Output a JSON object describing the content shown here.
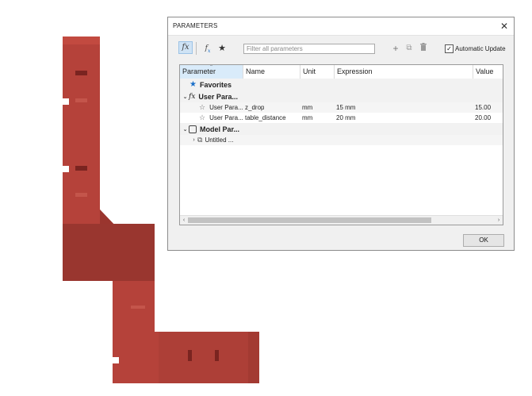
{
  "dialog": {
    "title": "PARAMETERS",
    "close_glyph": "✕",
    "filter_placeholder": "Filter all parameters",
    "auto_update_label": "Automatic Update",
    "auto_update_checked": true,
    "ok_label": "OK"
  },
  "toolbar_icons": {
    "parameters": "fx",
    "star": "★",
    "add": "+",
    "copy": "⧉",
    "delete": "🗑"
  },
  "columns": [
    "Parameter",
    "Name",
    "Unit",
    "Expression",
    "Value"
  ],
  "groups": {
    "favorites": "Favorites",
    "user_params": "User Para...",
    "model_params": "Model Par..."
  },
  "user_parameters": [
    {
      "parameter": "User Para...",
      "name": "z_drop",
      "unit": "mm",
      "expression": "15 mm",
      "value": "15.00"
    },
    {
      "parameter": "User Para...",
      "name": "table_distance",
      "unit": "mm",
      "expression": "20 mm",
      "value": "20.00"
    }
  ],
  "model_items": [
    {
      "label": "Untitled ..."
    }
  ],
  "colors": {
    "accent_blue": "#1a6fc9",
    "model_red": "#b5423a",
    "model_red_dark": "#8c2e28"
  }
}
